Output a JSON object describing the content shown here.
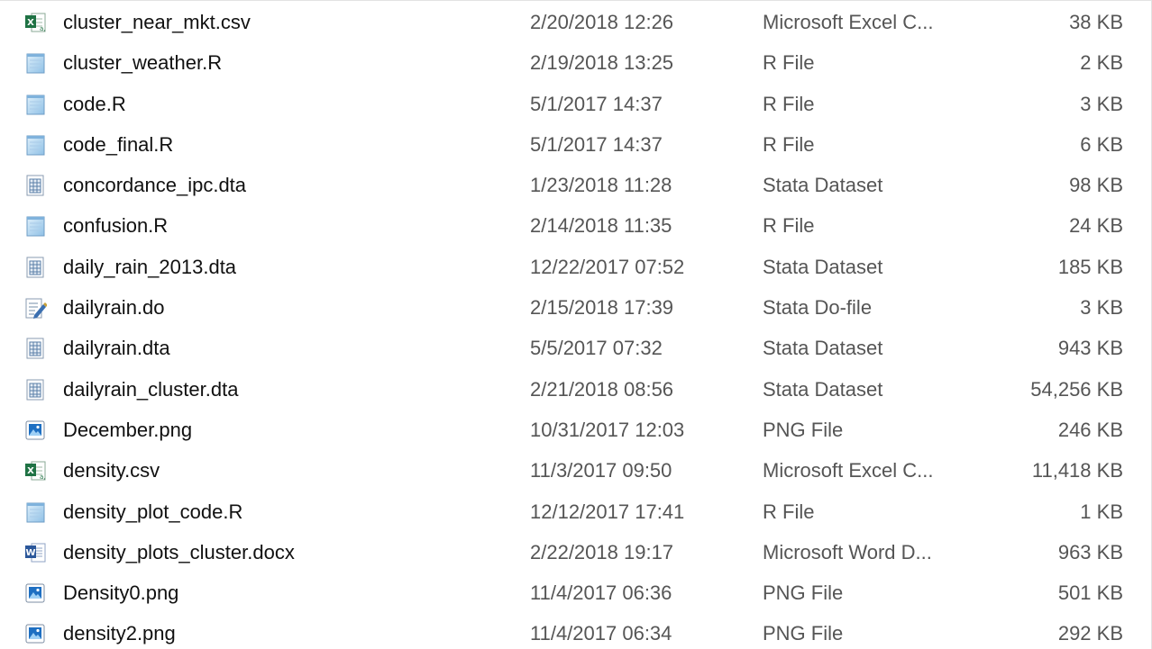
{
  "files": [
    {
      "name": "cluster_near_mkt.csv",
      "date": "2/20/2018 12:26",
      "type": "Microsoft Excel C...",
      "size": "38 KB",
      "icon": "excel-csv-icon"
    },
    {
      "name": "cluster_weather.R",
      "date": "2/19/2018 13:25",
      "type": "R File",
      "size": "2 KB",
      "icon": "r-file-icon"
    },
    {
      "name": "code.R",
      "date": "5/1/2017 14:37",
      "type": "R File",
      "size": "3 KB",
      "icon": "r-file-icon"
    },
    {
      "name": "code_final.R",
      "date": "5/1/2017 14:37",
      "type": "R File",
      "size": "6 KB",
      "icon": "r-file-icon"
    },
    {
      "name": "concordance_ipc.dta",
      "date": "1/23/2018 11:28",
      "type": "Stata Dataset",
      "size": "98 KB",
      "icon": "stata-dataset-icon"
    },
    {
      "name": "confusion.R",
      "date": "2/14/2018 11:35",
      "type": "R File",
      "size": "24 KB",
      "icon": "r-file-icon"
    },
    {
      "name": "daily_rain_2013.dta",
      "date": "12/22/2017 07:52",
      "type": "Stata Dataset",
      "size": "185 KB",
      "icon": "stata-dataset-icon"
    },
    {
      "name": "dailyrain.do",
      "date": "2/15/2018 17:39",
      "type": "Stata Do-file",
      "size": "3 KB",
      "icon": "stata-dofile-icon"
    },
    {
      "name": "dailyrain.dta",
      "date": "5/5/2017 07:32",
      "type": "Stata Dataset",
      "size": "943 KB",
      "icon": "stata-dataset-icon"
    },
    {
      "name": "dailyrain_cluster.dta",
      "date": "2/21/2018 08:56",
      "type": "Stata Dataset",
      "size": "54,256 KB",
      "icon": "stata-dataset-icon"
    },
    {
      "name": "December.png",
      "date": "10/31/2017 12:03",
      "type": "PNG File",
      "size": "246 KB",
      "icon": "png-image-icon"
    },
    {
      "name": "density.csv",
      "date": "11/3/2017 09:50",
      "type": "Microsoft Excel C...",
      "size": "11,418 KB",
      "icon": "excel-csv-icon"
    },
    {
      "name": "density_plot_code.R",
      "date": "12/12/2017 17:41",
      "type": "R File",
      "size": "1 KB",
      "icon": "r-file-icon"
    },
    {
      "name": "density_plots_cluster.docx",
      "date": "2/22/2018 19:17",
      "type": "Microsoft Word D...",
      "size": "963 KB",
      "icon": "word-doc-icon"
    },
    {
      "name": "Density0.png",
      "date": "11/4/2017 06:36",
      "type": "PNG File",
      "size": "501 KB",
      "icon": "png-image-icon"
    },
    {
      "name": "density2.png",
      "date": "11/4/2017 06:34",
      "type": "PNG File",
      "size": "292 KB",
      "icon": "png-image-icon"
    }
  ],
  "colors": {
    "excel_green": "#1f7244",
    "word_blue": "#2b579a",
    "png_blue": "#1e6fc2",
    "stata_blue": "#5a7fa8",
    "notepad_blue": "#7aaad8",
    "name_text": "#111111",
    "detail_text": "#555555"
  }
}
